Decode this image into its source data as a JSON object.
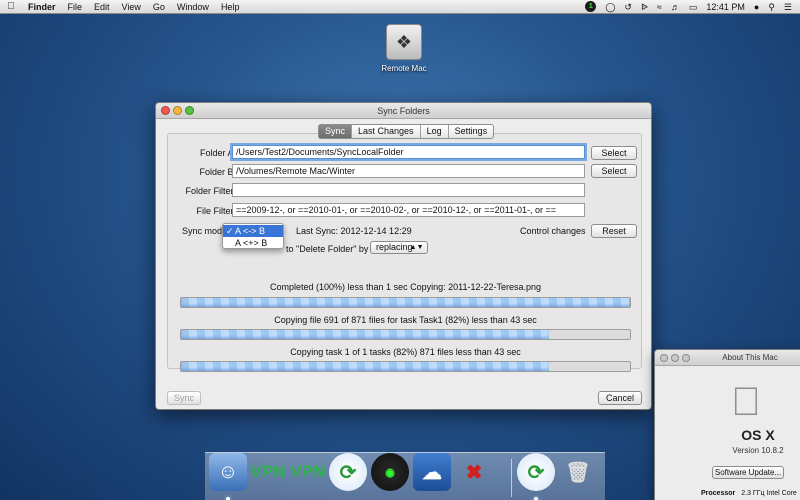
{
  "menubar": {
    "app": "Finder",
    "items": [
      "File",
      "Edit",
      "View",
      "Go",
      "Window",
      "Help"
    ],
    "status_badge": "1",
    "clock": "12:41 PM"
  },
  "desktop_icon": {
    "label": "Remote Mac"
  },
  "window": {
    "title": "Sync Folders",
    "tabs": [
      "Sync",
      "Last Changes",
      "Log",
      "Settings"
    ],
    "active_tab": "Sync",
    "folder_a": {
      "label": "Folder A:",
      "value": "/Users/Test2/Documents/SyncLocalFolder",
      "button": "Select"
    },
    "folder_b": {
      "label": "Folder B:",
      "value": "/Volumes/Remote Mac/Winter",
      "button": "Select"
    },
    "folder_filter": {
      "label": "Folder Filter:",
      "value": ""
    },
    "file_filter": {
      "label": "File Filter:",
      "value": "==2009-12-, or ==2010-01-, or ==2010-02-, or ==2010-12-, or ==2011-01-, or =="
    },
    "sync_mode_label": "Sync mode",
    "last_sync": "Last Sync: 2012-12-14 12:29",
    "control_changes_label": "Control changes",
    "reset_button": "Reset",
    "delete_folder_text": "to \"Delete Folder\" by",
    "delete_mode": "replacing",
    "sync_mode_menu": [
      {
        "label": "A <-> B",
        "selected": true
      },
      {
        "label": "A <+> B",
        "selected": false
      }
    ],
    "progress": [
      {
        "text": "Completed (100%) less than 1 sec Copying: 2011-12-22-Teresa.png",
        "fraction": 1.0
      },
      {
        "text": "Copying file 691 of 871 files for task Task1 (82%) less than 43 sec",
        "fraction": 0.82
      },
      {
        "text": "Copying task 1 of 1 tasks (82%) 871 files less than 43 sec",
        "fraction": 0.82
      }
    ],
    "sync_button": "Sync",
    "cancel_button": "Cancel"
  },
  "about": {
    "title": "About This Mac",
    "os": "OS X",
    "version": "Version 10.8.2",
    "update_button": "Software Update...",
    "processor_label": "Processor",
    "processor_value": "2.3 ГГц Intel Core"
  },
  "dock": {
    "vpn1": "VPN",
    "vpn2": "VPN"
  }
}
